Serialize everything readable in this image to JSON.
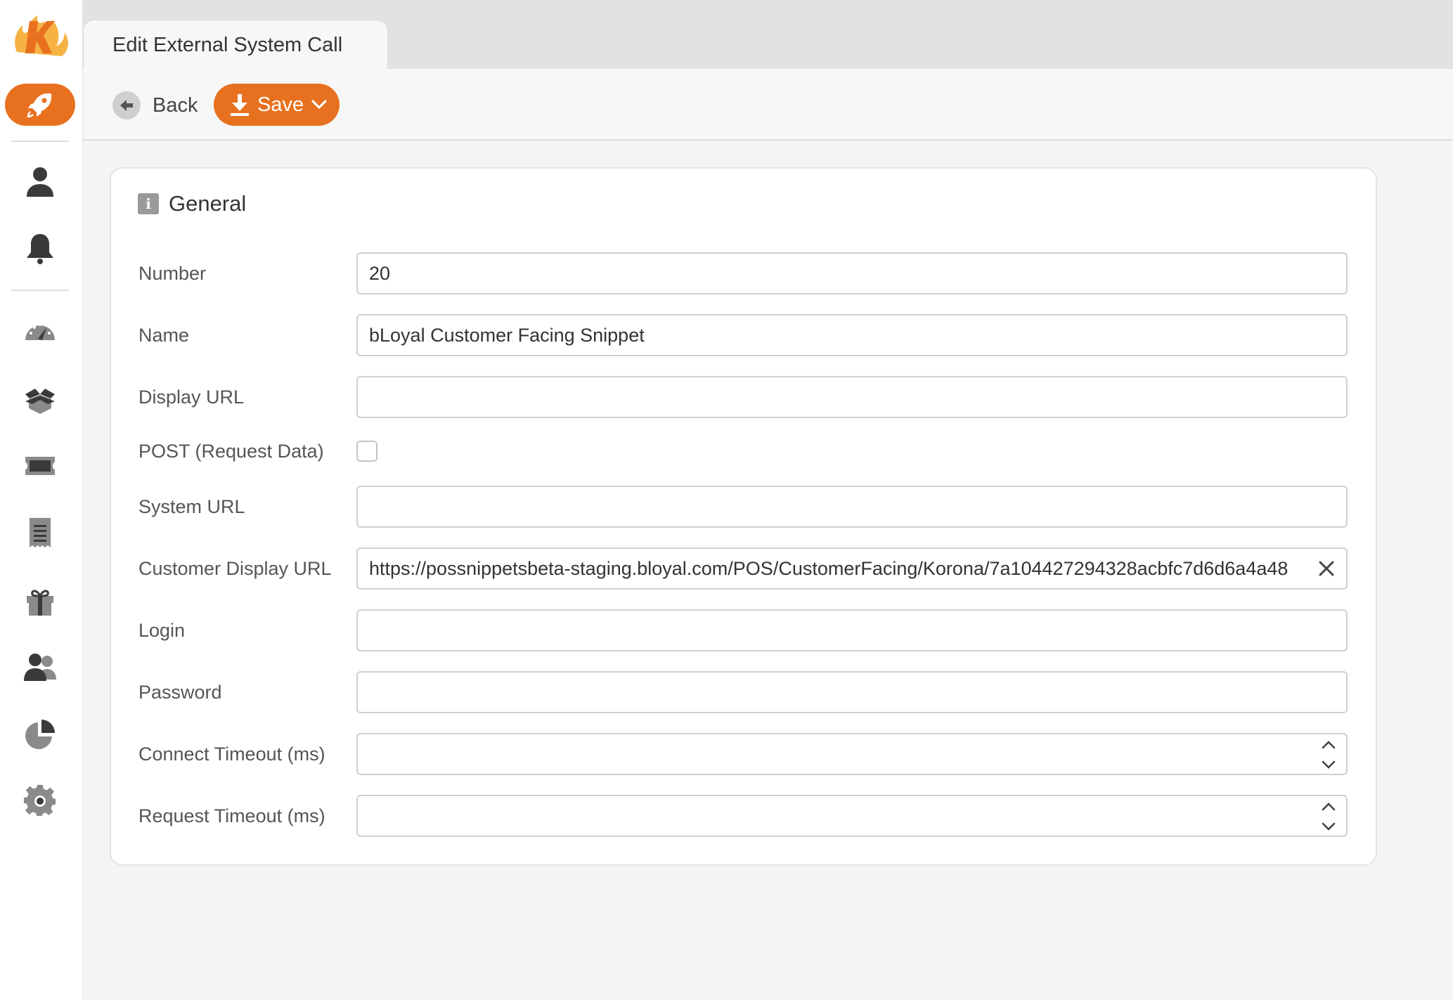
{
  "tab": {
    "title": "Edit External System Call"
  },
  "toolbar": {
    "back_label": "Back",
    "save_label": "Save"
  },
  "section": {
    "title": "General",
    "icon": "info-icon"
  },
  "form": {
    "number": {
      "label": "Number",
      "value": "20"
    },
    "name": {
      "label": "Name",
      "value": "bLoyal Customer Facing Snippet"
    },
    "display_url": {
      "label": "Display URL",
      "value": ""
    },
    "post": {
      "label": "POST (Request Data)",
      "checked": false
    },
    "system_url": {
      "label": "System URL",
      "value": ""
    },
    "customer_display_url": {
      "label": "Customer Display URL",
      "value": "https://possnippetsbeta-staging.bloyal.com/POS/CustomerFacing/Korona/7a104427294328acbfc7d6d6a4a48"
    },
    "login": {
      "label": "Login",
      "value": ""
    },
    "password": {
      "label": "Password",
      "value": ""
    },
    "connect_timeout": {
      "label": "Connect Timeout (ms)",
      "value": ""
    },
    "request_timeout": {
      "label": "Request Timeout (ms)",
      "value": ""
    }
  },
  "sidebar": {
    "icons": [
      "logo",
      "rocket-icon",
      "user-icon",
      "bell-icon",
      "dashboard-gauge-icon",
      "open-box-icon",
      "ticket-icon",
      "receipt-icon",
      "gift-icon",
      "users-icon",
      "pie-chart-icon",
      "gear-icon"
    ]
  },
  "colors": {
    "accent": "#e8711f",
    "sidebar_icon": "#3a3a3a",
    "muted_icon": "#8a8a8a"
  }
}
